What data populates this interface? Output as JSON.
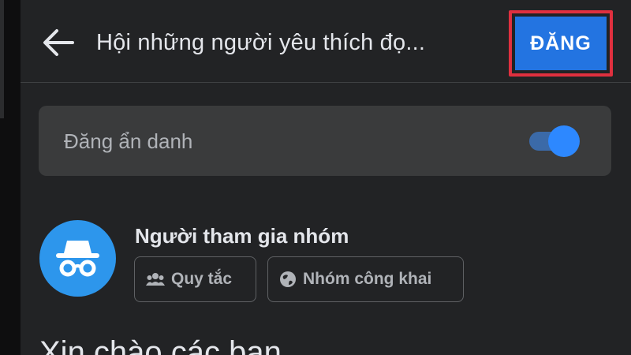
{
  "header": {
    "group_title": "Hội những người yêu thích đọ...",
    "post_button_label": "ĐĂNG"
  },
  "anonymous": {
    "label": "Đăng ẩn danh",
    "enabled": true
  },
  "author": {
    "name": "Người tham gia nhóm",
    "rules_chip": "Quy tắc",
    "privacy_chip": "Nhóm công khai"
  },
  "composer": {
    "text": "Xin chào các bạn"
  },
  "colors": {
    "accent": "#2374e1",
    "highlight_box": "#e0303f",
    "toggle_knob": "#2d88ff",
    "avatar_bg": "#2d96ec",
    "background": "#222325"
  },
  "icons": {
    "back": "arrow-left-icon",
    "avatar": "incognito-icon",
    "rules": "people-icon",
    "public": "globe-icon"
  }
}
